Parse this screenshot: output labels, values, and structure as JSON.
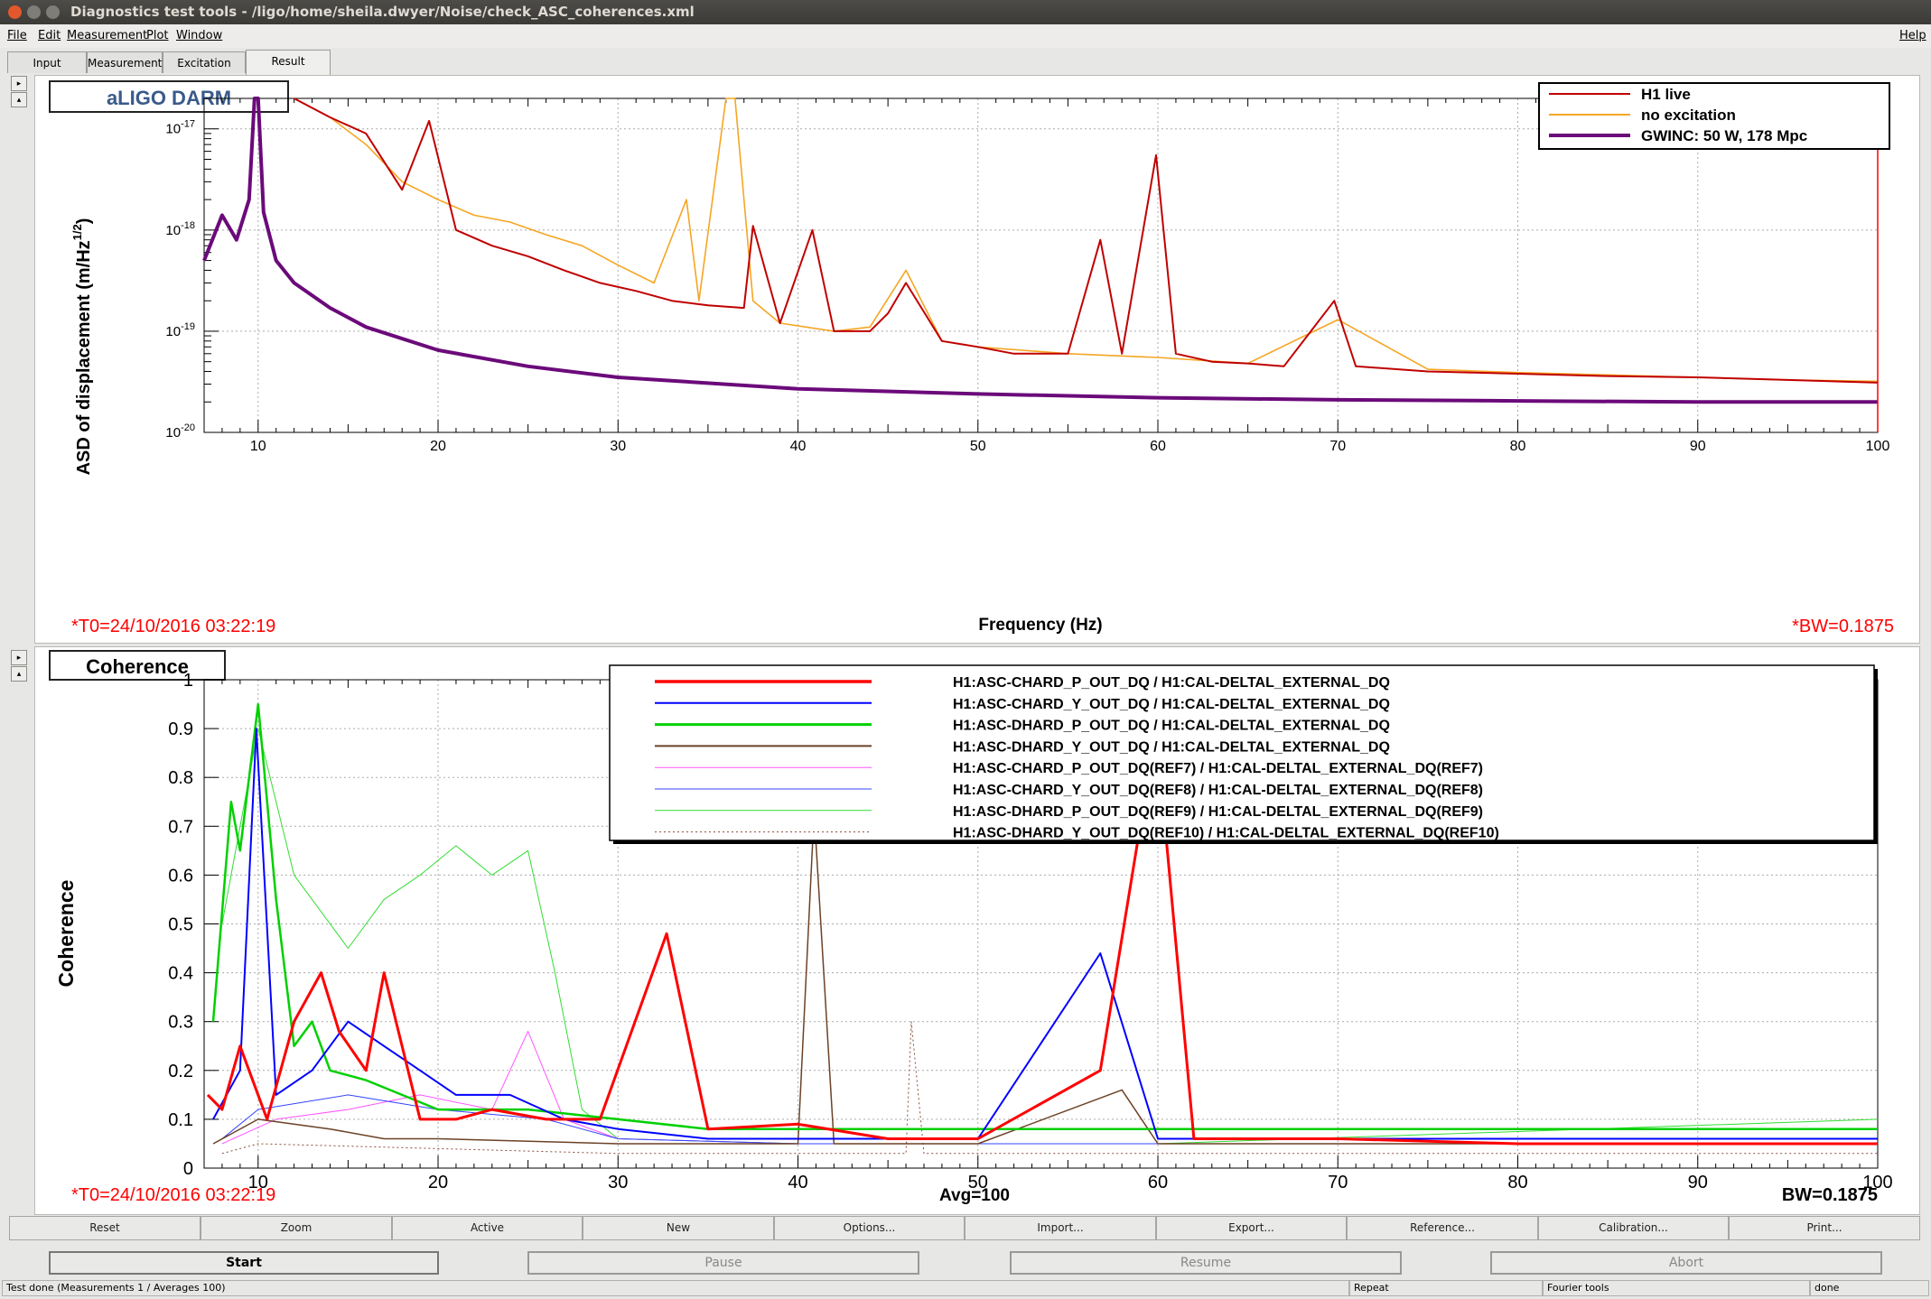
{
  "window": {
    "title": "Diagnostics test tools - /ligo/home/sheila.dwyer/Noise/check_ASC_coherences.xml"
  },
  "menu": {
    "file": "File",
    "edit": "Edit",
    "measurement": "Measurement",
    "plot": "Plot",
    "window": "Window",
    "help": "Help"
  },
  "tabs": {
    "input": "Input",
    "measurement": "Measurement",
    "excitation": "Excitation",
    "result": "Result",
    "active": "Result"
  },
  "pad_controls": {
    "top_arrow": "▸",
    "bottom_arrow": "▴"
  },
  "colors": {
    "h1_live": "#c00000",
    "no_excitation": "#f5a623",
    "gwinc": "#6b0a7a",
    "chard_p": "#ff0000",
    "chard_y": "#0000ff",
    "dhard_p": "#00d000",
    "dhard_y": "#6b4226",
    "ref7": "#ff55ff",
    "ref8": "#3344ff",
    "ref9": "#33dd33",
    "ref10": "#8b4a3a",
    "annot_red": "#ff0000"
  },
  "asd_panel": {
    "title": "aLIGO DARM",
    "ylabel": "ASD of displacement (m/Hz",
    "ylabel_sup": "1/2",
    "ylabel_end": ")",
    "xlabel": "Frequency (Hz)",
    "t0": "*T0=24/10/2016 03:22:19",
    "bw": "*BW=0.1875",
    "ytick_base": "10",
    "ytick_exps": [
      "-20",
      "-19",
      "-18",
      "-17"
    ],
    "xticks": [
      "10",
      "20",
      "30",
      "40",
      "50",
      "60",
      "70",
      "80",
      "90",
      "100"
    ],
    "legend": [
      "H1 live",
      "no excitation",
      "GWINC: 50 W, 178 Mpc"
    ]
  },
  "coh_panel": {
    "title": "Coherence",
    "ylabel": "Coherence",
    "avg": "Avg=100",
    "t0": "*T0=24/10/2016 03:22:19",
    "bw": "BW=0.1875",
    "yticks": [
      "0",
      "0.1",
      "0.2",
      "0.3",
      "0.4",
      "0.5",
      "0.6",
      "0.7",
      "0.8",
      "0.9",
      "1"
    ],
    "xticks": [
      "10",
      "20",
      "30",
      "40",
      "50",
      "60",
      "70",
      "80",
      "90",
      "100"
    ],
    "legend": [
      "H1:ASC-CHARD_P_OUT_DQ / H1:CAL-DELTAL_EXTERNAL_DQ",
      "H1:ASC-CHARD_Y_OUT_DQ / H1:CAL-DELTAL_EXTERNAL_DQ",
      "H1:ASC-DHARD_P_OUT_DQ / H1:CAL-DELTAL_EXTERNAL_DQ",
      "H1:ASC-DHARD_Y_OUT_DQ / H1:CAL-DELTAL_EXTERNAL_DQ",
      "H1:ASC-CHARD_P_OUT_DQ(REF7) / H1:CAL-DELTAL_EXTERNAL_DQ(REF7)",
      "H1:ASC-CHARD_Y_OUT_DQ(REF8) / H1:CAL-DELTAL_EXTERNAL_DQ(REF8)",
      "H1:ASC-DHARD_P_OUT_DQ(REF9) / H1:CAL-DELTAL_EXTERNAL_DQ(REF9)",
      "H1:ASC-DHARD_Y_OUT_DQ(REF10) / H1:CAL-DELTAL_EXTERNAL_DQ(REF10)"
    ]
  },
  "buttons": [
    "Reset",
    "Zoom",
    "Active",
    "New",
    "Options...",
    "Import...",
    "Export...",
    "Reference...",
    "Calibration...",
    "Print..."
  ],
  "controls": {
    "start": "Start",
    "pause": "Pause",
    "resume": "Resume",
    "abort": "Abort"
  },
  "status": {
    "message": "Test done (Measurements 1 / Averages 100)",
    "repeat": "Repeat",
    "tools": "Fourier tools",
    "state": "done"
  },
  "chart_data": [
    {
      "type": "line",
      "title": "aLIGO DARM",
      "xlabel": "Frequency (Hz)",
      "ylabel": "ASD of displacement (m/Hz^1/2)",
      "xlim": [
        7,
        100
      ],
      "ylim": [
        1e-20,
        2e-17
      ],
      "yscale": "log",
      "grid": true,
      "legend_position": "top-right",
      "series": [
        {
          "name": "H1 live",
          "x": [
            12,
            14,
            16,
            18,
            19.5,
            21,
            23,
            25,
            27,
            29,
            31,
            33,
            35,
            37,
            37.5,
            39,
            40.8,
            42,
            44,
            45,
            46,
            48,
            50,
            52,
            55,
            56.8,
            58,
            59.9,
            61,
            63,
            65,
            67,
            69.8,
            71,
            75,
            80,
            85,
            90,
            95,
            100
          ],
          "y": [
            2e-17,
            1.3e-17,
            9e-18,
            2.5e-18,
            1.2e-17,
            1e-18,
            7e-19,
            5.5e-19,
            4e-19,
            3e-19,
            2.5e-19,
            2e-19,
            1.8e-19,
            1.7e-19,
            1.1e-18,
            1.2e-19,
            1e-18,
            1e-19,
            1e-19,
            1.5e-19,
            3e-19,
            8e-20,
            7e-20,
            6e-20,
            6e-20,
            8e-19,
            6e-20,
            5.5e-18,
            6e-20,
            5e-20,
            4.8e-20,
            4.5e-20,
            2e-19,
            4.5e-20,
            4e-20,
            3.8e-20,
            3.6e-20,
            3.5e-20,
            3.3e-20,
            3.1e-20
          ]
        },
        {
          "name": "no excitation",
          "x": [
            12,
            14,
            16,
            18,
            20,
            22,
            24,
            26,
            28,
            30,
            32,
            33.8,
            34.5,
            36,
            36.5,
            37.5,
            39,
            42,
            44,
            46,
            48,
            50,
            55,
            60,
            65,
            70,
            75,
            80,
            85,
            90,
            95,
            100
          ],
          "y": [
            2e-17,
            1.3e-17,
            7e-18,
            3e-18,
            2e-18,
            1.4e-18,
            1.2e-18,
            9e-19,
            7e-19,
            4.5e-19,
            3e-19,
            2e-18,
            2e-19,
            2e-17,
            2e-17,
            2e-19,
            1.2e-19,
            1e-19,
            1.1e-19,
            4e-19,
            8e-20,
            7e-20,
            6e-20,
            5.5e-20,
            4.8e-20,
            1.3e-19,
            4.2e-20,
            3.9e-20,
            3.7e-20,
            3.5e-20,
            3.3e-20,
            3.2e-20
          ]
        },
        {
          "name": "GWINC: 50 W, 178 Mpc",
          "x": [
            7,
            8,
            8.8,
            9.5,
            9.8,
            10,
            10.3,
            11,
            12,
            14,
            16,
            20,
            25,
            30,
            40,
            50,
            60,
            70,
            80,
            90,
            100
          ],
          "y": [
            5e-19,
            1.4e-18,
            8e-19,
            2e-18,
            2e-17,
            2e-17,
            1.5e-18,
            5e-19,
            3e-19,
            1.7e-19,
            1.1e-19,
            6.5e-20,
            4.5e-20,
            3.5e-20,
            2.7e-20,
            2.4e-20,
            2.2e-20,
            2.1e-20,
            2.05e-20,
            2e-20,
            2e-20
          ]
        }
      ]
    },
    {
      "type": "line",
      "title": "Coherence",
      "xlabel": "",
      "ylabel": "Coherence",
      "xlim": [
        7,
        100
      ],
      "ylim": [
        0,
        1
      ],
      "grid": true,
      "legend_position": "top",
      "series": [
        {
          "name": "H1:ASC-CHARD_P_OUT_DQ / H1:CAL-DELTAL_EXTERNAL_DQ",
          "x": [
            7.2,
            8,
            9,
            10.5,
            12,
            13.5,
            14.5,
            16,
            17,
            19,
            21,
            23,
            26,
            29,
            32.7,
            35,
            40,
            45,
            50,
            56.8,
            59.9,
            62,
            70,
            80,
            90,
            100
          ],
          "y": [
            0.15,
            0.12,
            0.25,
            0.1,
            0.3,
            0.4,
            0.28,
            0.2,
            0.4,
            0.1,
            0.1,
            0.12,
            0.1,
            0.1,
            0.48,
            0.08,
            0.09,
            0.06,
            0.06,
            0.2,
            0.9,
            0.06,
            0.06,
            0.05,
            0.05,
            0.05
          ]
        },
        {
          "name": "H1:ASC-CHARD_Y_OUT_DQ / H1:CAL-DELTAL_EXTERNAL_DQ",
          "x": [
            7.5,
            9,
            9.9,
            11,
            13,
            15,
            17,
            19,
            21,
            24,
            27,
            30,
            35,
            40,
            50,
            56.8,
            60,
            70,
            80,
            90,
            100
          ],
          "y": [
            0.1,
            0.2,
            0.9,
            0.15,
            0.2,
            0.3,
            0.25,
            0.2,
            0.15,
            0.15,
            0.1,
            0.08,
            0.06,
            0.06,
            0.06,
            0.44,
            0.06,
            0.06,
            0.06,
            0.06,
            0.06
          ]
        },
        {
          "name": "H1:ASC-DHARD_P_OUT_DQ / H1:CAL-DELTAL_EXTERNAL_DQ",
          "x": [
            7.5,
            8.5,
            9,
            10,
            11,
            12,
            13,
            14,
            16,
            18,
            20,
            25,
            30,
            35,
            40,
            50,
            60,
            70,
            80,
            90,
            100
          ],
          "y": [
            0.3,
            0.75,
            0.65,
            0.95,
            0.55,
            0.25,
            0.3,
            0.2,
            0.18,
            0.15,
            0.12,
            0.12,
            0.1,
            0.08,
            0.08,
            0.08,
            0.08,
            0.08,
            0.08,
            0.08,
            0.08
          ]
        },
        {
          "name": "H1:ASC-DHARD_Y_OUT_DQ / H1:CAL-DELTAL_EXTERNAL_DQ",
          "x": [
            7.5,
            10,
            14,
            17,
            20,
            30,
            40,
            40.9,
            42,
            50,
            58,
            60,
            70,
            80,
            90,
            100
          ],
          "y": [
            0.05,
            0.1,
            0.08,
            0.06,
            0.06,
            0.05,
            0.05,
            0.73,
            0.05,
            0.05,
            0.16,
            0.05,
            0.05,
            0.05,
            0.05,
            0.05
          ]
        },
        {
          "name": "H1:ASC-CHARD_P_OUT_DQ(REF7) / H1:CAL-DELTAL_EXTERNAL_DQ(REF7)",
          "x": [
            8,
            11,
            15,
            19,
            23,
            25,
            27,
            30,
            40,
            60,
            100
          ],
          "y": [
            0.05,
            0.1,
            0.12,
            0.15,
            0.12,
            0.28,
            0.1,
            0.06,
            0.05,
            0.05,
            0.05
          ]
        },
        {
          "name": "H1:ASC-CHARD_Y_OUT_DQ(REF8) / H1:CAL-DELTAL_EXTERNAL_DQ(REF8)",
          "x": [
            8,
            10,
            15,
            20,
            26,
            30,
            40,
            60,
            100
          ],
          "y": [
            0.06,
            0.12,
            0.15,
            0.12,
            0.1,
            0.06,
            0.05,
            0.05,
            0.05
          ]
        },
        {
          "name": "H1:ASC-DHARD_P_OUT_DQ(REF9) / H1:CAL-DELTAL_EXTERNAL_DQ(REF9)",
          "x": [
            8,
            10,
            12,
            15,
            17,
            19,
            21,
            23,
            25,
            26.5,
            28,
            30,
            40,
            60,
            100
          ],
          "y": [
            0.5,
            0.9,
            0.6,
            0.45,
            0.55,
            0.6,
            0.66,
            0.6,
            0.65,
            0.4,
            0.12,
            0.06,
            0.05,
            0.05,
            0.1
          ]
        },
        {
          "name": "H1:ASC-DHARD_Y_OUT_DQ(REF10) / H1:CAL-DELTAL_EXTERNAL_DQ(REF10)",
          "x": [
            8,
            10,
            20,
            30,
            40,
            46,
            46.3,
            47,
            60,
            100
          ],
          "y": [
            0.03,
            0.05,
            0.04,
            0.03,
            0.03,
            0.03,
            0.3,
            0.03,
            0.03,
            0.03
          ]
        }
      ]
    }
  ]
}
